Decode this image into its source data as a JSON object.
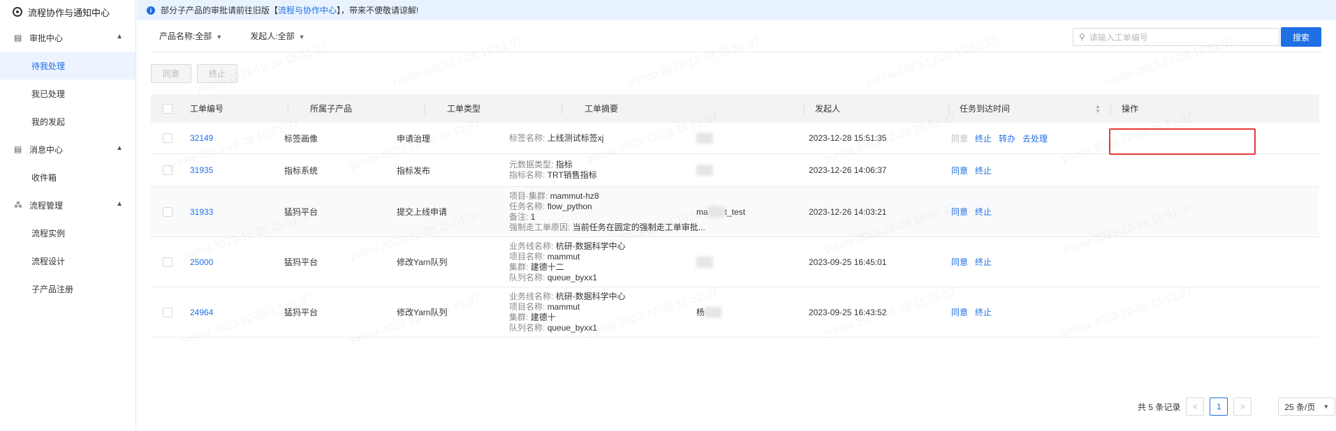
{
  "sidebar": {
    "brand": "流程协作与通知中心",
    "groups": [
      {
        "label": "审批中心",
        "items": [
          "待我处理",
          "我已处理",
          "我的发起"
        ]
      },
      {
        "label": "消息中心",
        "items": [
          "收件箱"
        ]
      },
      {
        "label": "流程管理",
        "items": [
          "流程实例",
          "流程设计",
          "子产品注册"
        ]
      }
    ],
    "active_item": "待我处理"
  },
  "notice": {
    "prefix": "部分子产品的审批请前往旧版【",
    "link": "流程与协作中心",
    "suffix": "】，带来不便敬请谅解!"
  },
  "filters": {
    "product": "产品名称:全部",
    "initiator": "发起人:全部"
  },
  "search": {
    "placeholder": "请输入工单编号",
    "button": "搜索"
  },
  "bulk": {
    "agree": "同意",
    "terminate": "终止"
  },
  "table": {
    "headers": [
      "工单编号",
      "所属子产品",
      "工单类型",
      "工单摘要",
      "发起人",
      "任务到达时间",
      "操作"
    ],
    "rows": [
      {
        "id": "32149",
        "product": "标签画像",
        "type": "申请治理",
        "summary": [
          {
            "k": "标签名称:",
            "v": "上线测试标签xj"
          }
        ],
        "initiator_prefix": "",
        "initiator_suffix": "",
        "time": "2023-12-28 15:51:35",
        "ops": [
          {
            "label": "同意",
            "disabled": true
          },
          {
            "label": "终止"
          },
          {
            "label": "转办"
          },
          {
            "label": "去处理"
          }
        ]
      },
      {
        "id": "31935",
        "product": "指标系统",
        "type": "指标发布",
        "summary": [
          {
            "k": "元数据类型:",
            "v": "指标"
          },
          {
            "k": "指标名称:",
            "v": "TRT销售指标"
          }
        ],
        "initiator_prefix": "",
        "initiator_suffix": "",
        "time": "2023-12-26 14:06:37",
        "ops": [
          {
            "label": "同意"
          },
          {
            "label": "终止"
          }
        ]
      },
      {
        "id": "31933",
        "product": "猛犸平台",
        "type": "提交上线申请",
        "summary": [
          {
            "k": "项目-集群:",
            "v": "mammut-hz8"
          },
          {
            "k": "任务名称:",
            "v": "flow_python"
          },
          {
            "k": "备注:",
            "v": "1"
          },
          {
            "k": "强制走工单原因:",
            "v": "当前任务在圆定的强制走工单审批..."
          }
        ],
        "initiator_prefix": "ma",
        "initiator_suffix": "t_test",
        "time": "2023-12-26 14:03:21",
        "ops": [
          {
            "label": "同意"
          },
          {
            "label": "终止"
          }
        ]
      },
      {
        "id": "25000",
        "product": "猛犸平台",
        "type": "修改Yarn队列",
        "summary": [
          {
            "k": "业务线名称:",
            "v": "杭研-数据科学中心"
          },
          {
            "k": "项目名称:",
            "v": "mammut"
          },
          {
            "k": "集群:",
            "v": "建德十二"
          },
          {
            "k": "队列名称:",
            "v": "queue_byxx1"
          }
        ],
        "initiator_prefix": "",
        "initiator_suffix": "",
        "time": "2023-09-25 16:45:01",
        "ops": [
          {
            "label": "同意"
          },
          {
            "label": "终止"
          }
        ]
      },
      {
        "id": "24964",
        "product": "猛犸平台",
        "type": "修改Yarn队列",
        "summary": [
          {
            "k": "业务线名称:",
            "v": "杭研-数据科学中心"
          },
          {
            "k": "项目名称:",
            "v": "mammut"
          },
          {
            "k": "集群:",
            "v": "建德十"
          },
          {
            "k": "队列名称:",
            "v": "queue_byxx1"
          }
        ],
        "initiator_prefix": "杨",
        "initiator_suffix": "",
        "time": "2023-09-25 16:43:52",
        "ops": [
          {
            "label": "同意"
          },
          {
            "label": "终止"
          }
        ]
      }
    ]
  },
  "pagination": {
    "total": "共 5 条记录",
    "prev": "<",
    "current": "1",
    "next": ">",
    "page_size": "25 条/页"
  },
  "watermark": "yunna 2023-12-28 15:51:37",
  "colors": {
    "accent": "#1f6fe5",
    "highlight": "#e53935",
    "notice_bg": "#e8f3ff"
  }
}
